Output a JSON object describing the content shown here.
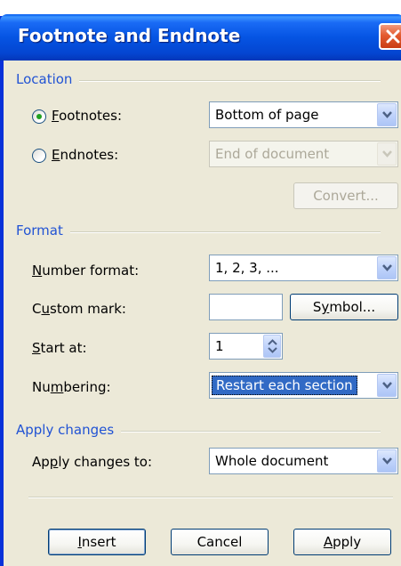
{
  "window": {
    "title": "Footnote and Endnote"
  },
  "location": {
    "group_label": "Location",
    "footnotes_label_accel": "F",
    "footnotes_label_rest": "ootnotes:",
    "footnotes_value": "Bottom of page",
    "footnotes_selected": true,
    "endnotes_label_accel": "E",
    "endnotes_label_rest": "ndnotes:",
    "endnotes_value": "End of document",
    "convert_label": "Convert..."
  },
  "format": {
    "group_label": "Format",
    "number_format_accel": "N",
    "number_format_rest": "umber format:",
    "number_format_value": "1, 2, 3, ...",
    "custom_mark_pre": "C",
    "custom_mark_accel": "u",
    "custom_mark_rest": "stom mark:",
    "custom_mark_value": "",
    "symbol_pre": "S",
    "symbol_accel": "y",
    "symbol_rest": "mbol...",
    "start_at_accel": "S",
    "start_at_rest": "tart at:",
    "start_at_value": "1",
    "numbering_pre": "Nu",
    "numbering_accel": "m",
    "numbering_rest": "bering:",
    "numbering_value": "Restart each section"
  },
  "apply_changes": {
    "group_label": "Apply changes",
    "apply_to_pre": "Ap",
    "apply_to_accel": "p",
    "apply_to_rest": "ly changes to:",
    "apply_to_value": "Whole document"
  },
  "buttons": {
    "insert_accel": "I",
    "insert_rest": "nsert",
    "cancel_label": "Cancel",
    "apply_accel": "A",
    "apply_rest": "pply"
  },
  "colors": {
    "title_bar": "#0554e3",
    "group_label": "#2153d4",
    "selection": "#316ac5",
    "close_button": "#e35b2f",
    "dialog_face": "#ece9d8"
  }
}
